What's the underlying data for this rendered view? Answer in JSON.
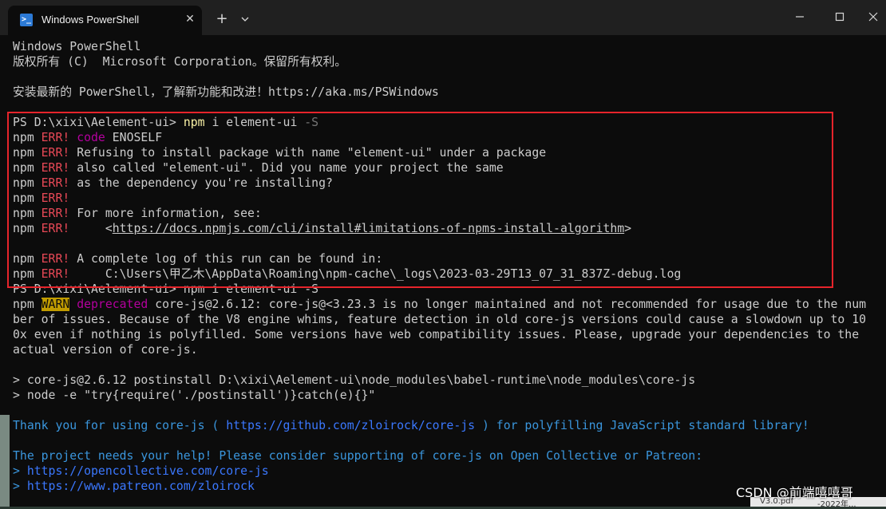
{
  "window": {
    "tab_title": "Windows PowerShell",
    "tab_icon_glyph": ">_",
    "close_glyph": "✕",
    "new_tab_glyph": "+",
    "colors": {
      "background": "#0c0c0c",
      "titlebar": "#202020",
      "text": "#cccccc",
      "error_red": "#e74856",
      "warn_bg": "#c19c00",
      "deprecated_magenta": "#b4009e",
      "command_yellow": "#f9f1a5",
      "info_cyan": "#3a96dd",
      "link_blue": "#3b78ff",
      "annotation_box": "#e6242b"
    }
  },
  "terminal": {
    "l1": "Windows PowerShell",
    "l2": "版权所有 (C)  Microsoft Corporation。保留所有权利。",
    "l4": "安装最新的 PowerShell，了解新功能和改进！https://aka.ms/PSWindows",
    "prompt1": "PS D:\\xixi\\Aelement-ui> ",
    "cmd1_a": "npm",
    "cmd1_b": " i element-ui ",
    "cmd1_c": "-S",
    "npm": "npm ",
    "err": "ERR!",
    "code_kw": "code",
    "code_val": " ENOSELF",
    "e2": " Refusing to install package with name \"element-ui\" under a package",
    "e3": " also called \"element-ui\". Did you name your project the same",
    "e4": " as the dependency you're installing?",
    "e6": " For more information, see:",
    "e7_pad": "     <",
    "e7_link": "https://docs.npmjs.com/cli/install#limitations-of-npms-install-algorithm",
    "e7_end": ">",
    "e9": " A complete log of this run can be found in:",
    "e10": "     C:\\Users\\甲乙木\\AppData\\Roaming\\npm-cache\\_logs\\2023-03-29T13_07_31_837Z-debug.log",
    "prompt2": "PS D:\\xixi\\Aelement-ui> npm i element-ui -S",
    "warn": "WARN",
    "deprecated": "deprecated",
    "w1_rest": " core-js@2.6.12: core-js@<3.23.3 is no longer maintained and not recommended for usage due to the num",
    "w2": "ber of issues. Because of the V8 engine whims, feature detection in old core-js versions could cause a slowdown up to 10",
    "w3": "0x even if nothing is polyfilled. Some versions have web compatibility issues. Please, upgrade your dependencies to the",
    "w4": "actual version of core-js.",
    "p1": "> core-js@2.6.12 postinstall D:\\xixi\\Aelement-ui\\node_modules\\babel-runtime\\node_modules\\core-js",
    "p2": "> node -e \"try{require('./postinstall')}catch(e){}\"",
    "t1_a": "Thank you for using core-js ( ",
    "t1_link": "https://github.com/zloirock/core-js",
    "t1_b": " ) for polyfilling JavaScript standard library!",
    "t2": "The project needs your help! Please consider supporting of core-js on Open Collective or Patreon:",
    "t3_gt": "> ",
    "t3_link": "https://opencollective.com/core-js",
    "t4_gt": "> ",
    "t4_link": "https://www.patreon.com/zloirock"
  },
  "overlay": {
    "watermark": "CSDN @前端嘻嘻哥",
    "peek_a": "V3.0.pdf",
    "peek_b": "-2022年..."
  }
}
